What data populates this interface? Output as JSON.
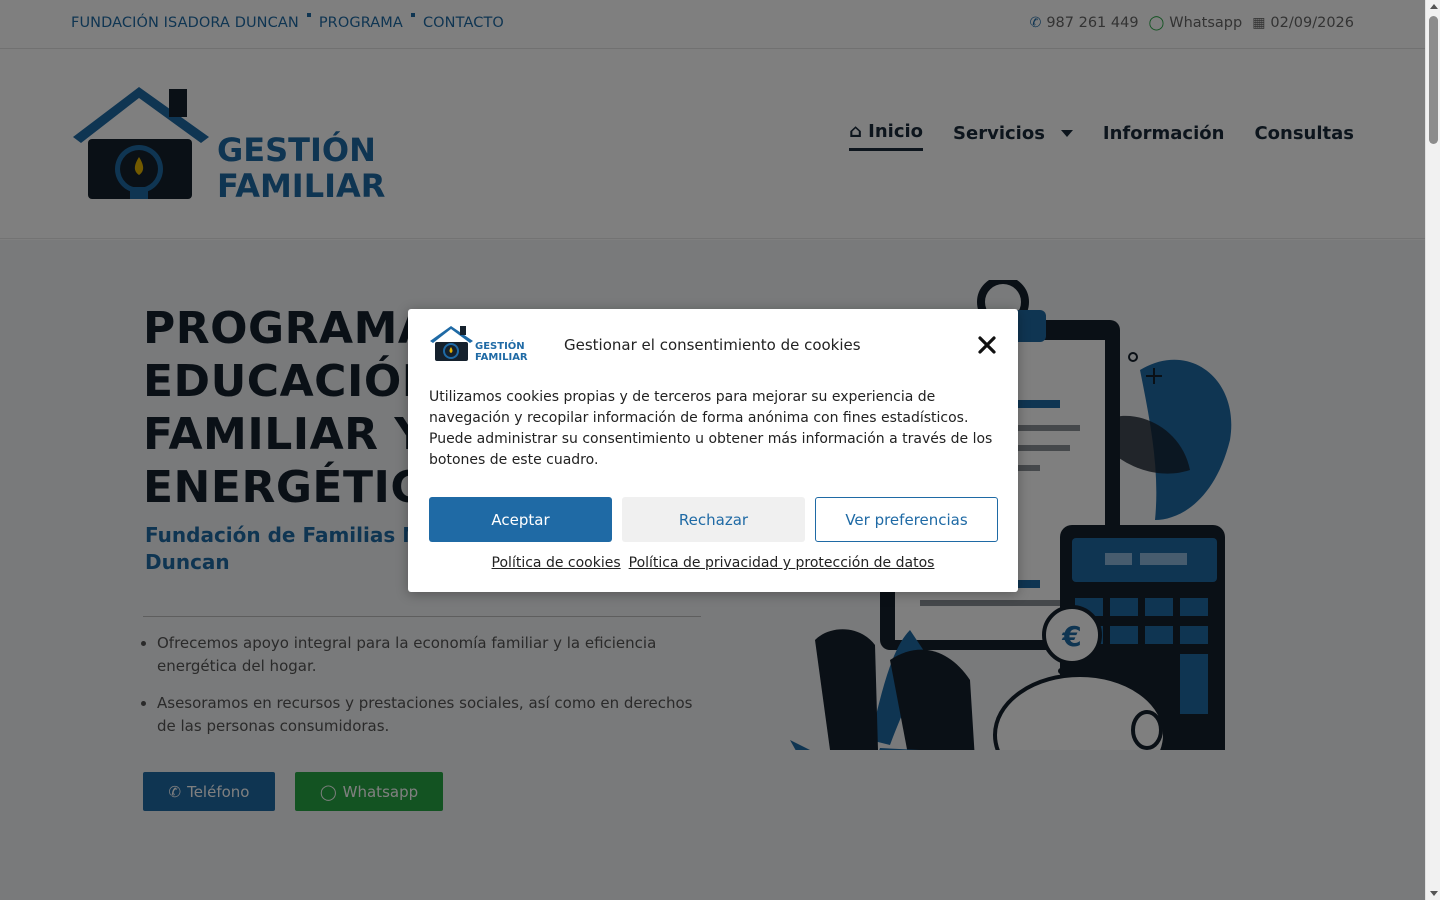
{
  "topbar": {
    "links": [
      "FUNDACIÓN ISADORA DUNCAN",
      "PROGRAMA",
      "CONTACTO"
    ],
    "phone": "987 261 449",
    "whatsapp": "Whatsapp",
    "date": "02/09/2026"
  },
  "header": {
    "logo_text_1": "GESTIÓN",
    "logo_text_2": "FAMILIAR",
    "nav": [
      "Inicio",
      "Servicios",
      "Información",
      "Consultas"
    ]
  },
  "hero": {
    "title_lines": [
      "PROGRAMA",
      "EDUCACIÓN",
      "FAMILIAR Y A",
      "ENERGÉTICO"
    ],
    "subtitle_lines": [
      "Fundación de Familias M",
      "Duncan"
    ],
    "bullets": [
      "Ofrecemos apoyo integral para la economía familiar y la eficiencia energética del hogar.",
      "Asesoramos en recursos y prestaciones sociales, así como en derechos de las personas consumidoras."
    ],
    "btn_phone": "Teléfono",
    "btn_whatsapp": "Whatsapp"
  },
  "cookie_modal": {
    "logo_text_1": "GESTIÓN",
    "logo_text_2": "FAMILIAR",
    "title": "Gestionar el consentimiento de cookies",
    "body": "Utilizamos cookies propias y de terceros para mejorar su experiencia de navegación y recopilar información de forma anónima con fines estadísticos. Puede administrar su consentimiento u obtener más información a través de los botones de este cuadro.",
    "accept": "Aceptar",
    "reject": "Rechazar",
    "preferences": "Ver preferencias",
    "link_cookies": "Política de cookies",
    "link_privacy": "Política de privacidad y protección de datos"
  },
  "colors": {
    "brand_blue": "#1f6aa5",
    "brand_dark": "#15212d",
    "whatsapp_green": "#27a744"
  }
}
